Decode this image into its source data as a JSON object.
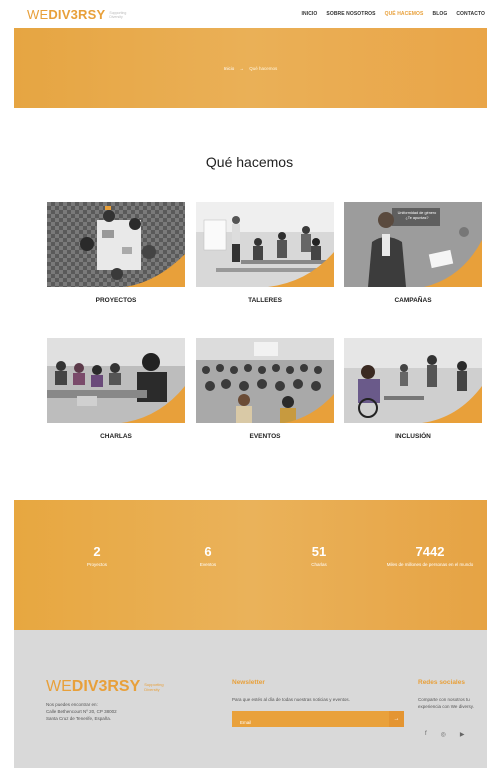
{
  "header": {
    "logo_we": "WE",
    "logo_diversy": "DIV3RSY",
    "logo_tagline": "Supporting Diversity",
    "nav": [
      {
        "label": "INICIO",
        "active": false
      },
      {
        "label": "SOBRE NOSOTROS",
        "active": false
      },
      {
        "label": "QUÉ HACEMOS",
        "active": true
      },
      {
        "label": "BLOG",
        "active": false
      },
      {
        "label": "CONTACTO",
        "active": false
      }
    ]
  },
  "hero": {
    "breadcrumb_home": "Inicio",
    "breadcrumb_arrow": "→",
    "breadcrumb_current": "Qué hacemos"
  },
  "section": {
    "title": "Qué hacemos"
  },
  "cards": [
    {
      "label": "PROYECTOS"
    },
    {
      "label": "TALLERES"
    },
    {
      "label": "CAMPAÑAS",
      "overlay_line1": "Uniformidad de género",
      "overlay_line2": "¿Te apuntas?"
    },
    {
      "label": "CHARLAS"
    },
    {
      "label": "EVENTOS"
    },
    {
      "label": "INCLUSIÓN"
    }
  ],
  "stats": [
    {
      "number": "2",
      "label": "Proyectos"
    },
    {
      "number": "6",
      "label": "Eventos"
    },
    {
      "number": "51",
      "label": "Charlas"
    },
    {
      "number": "7442",
      "label": "Miles de millones de personas en el mundo"
    }
  ],
  "footer": {
    "logo_we": "WE",
    "logo_diversy": "DIV3RSY",
    "logo_tagline": "Supporting Diversity",
    "address_line1": "Nos puedes encontrar en:",
    "address_line2": "Calle Bethencourt Nº 20, CP 38002",
    "address_line3": "Santa Cruz de Tenerife, España.",
    "newsletter_title": "Newsletter",
    "newsletter_text": "Para que estés al día de todas nuestras noticias y eventos.",
    "email_placeholder": "Email",
    "submit_icon": "→",
    "social_title": "Redes sociales",
    "social_text": "Comparte con nosotros tu experiencia con We diversy.",
    "social_icons": [
      "f",
      "◎",
      "▶"
    ]
  },
  "colors": {
    "accent": "#e8a03a",
    "footer_bg": "#d9d9d9"
  }
}
